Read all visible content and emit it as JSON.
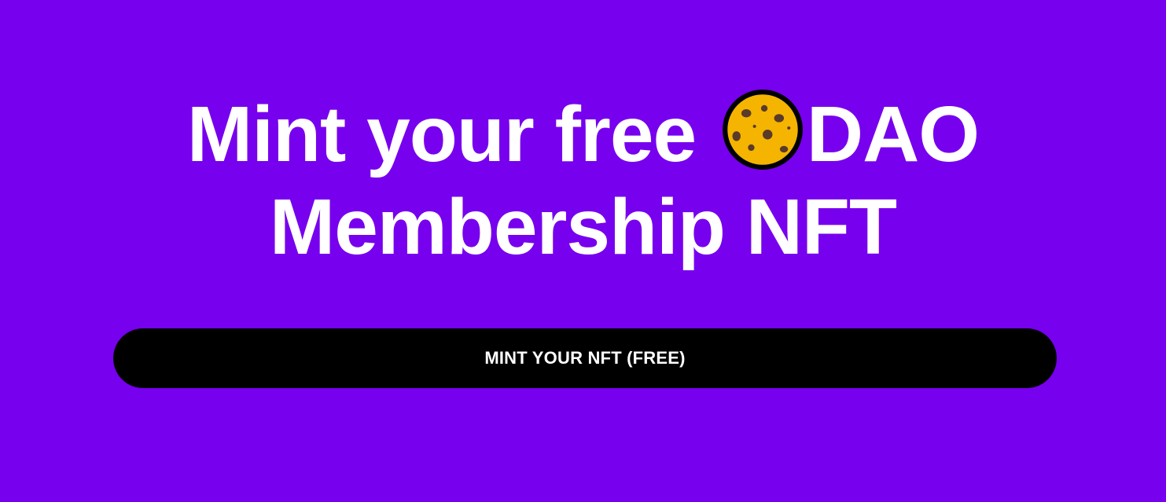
{
  "hero": {
    "line1_text": "Mint your free",
    "line1_suffix": "DAO",
    "line2_text": "Membership NFT",
    "emoji_icon": "cookie-icon"
  },
  "mint_button": {
    "label": "MINT YOUR NFT (FREE)"
  },
  "colors": {
    "background": "#7700ee",
    "button_background": "#000000",
    "text": "#ffffff",
    "cookie_fill": "#f5b400",
    "cookie_chip": "#5a3a2a"
  }
}
